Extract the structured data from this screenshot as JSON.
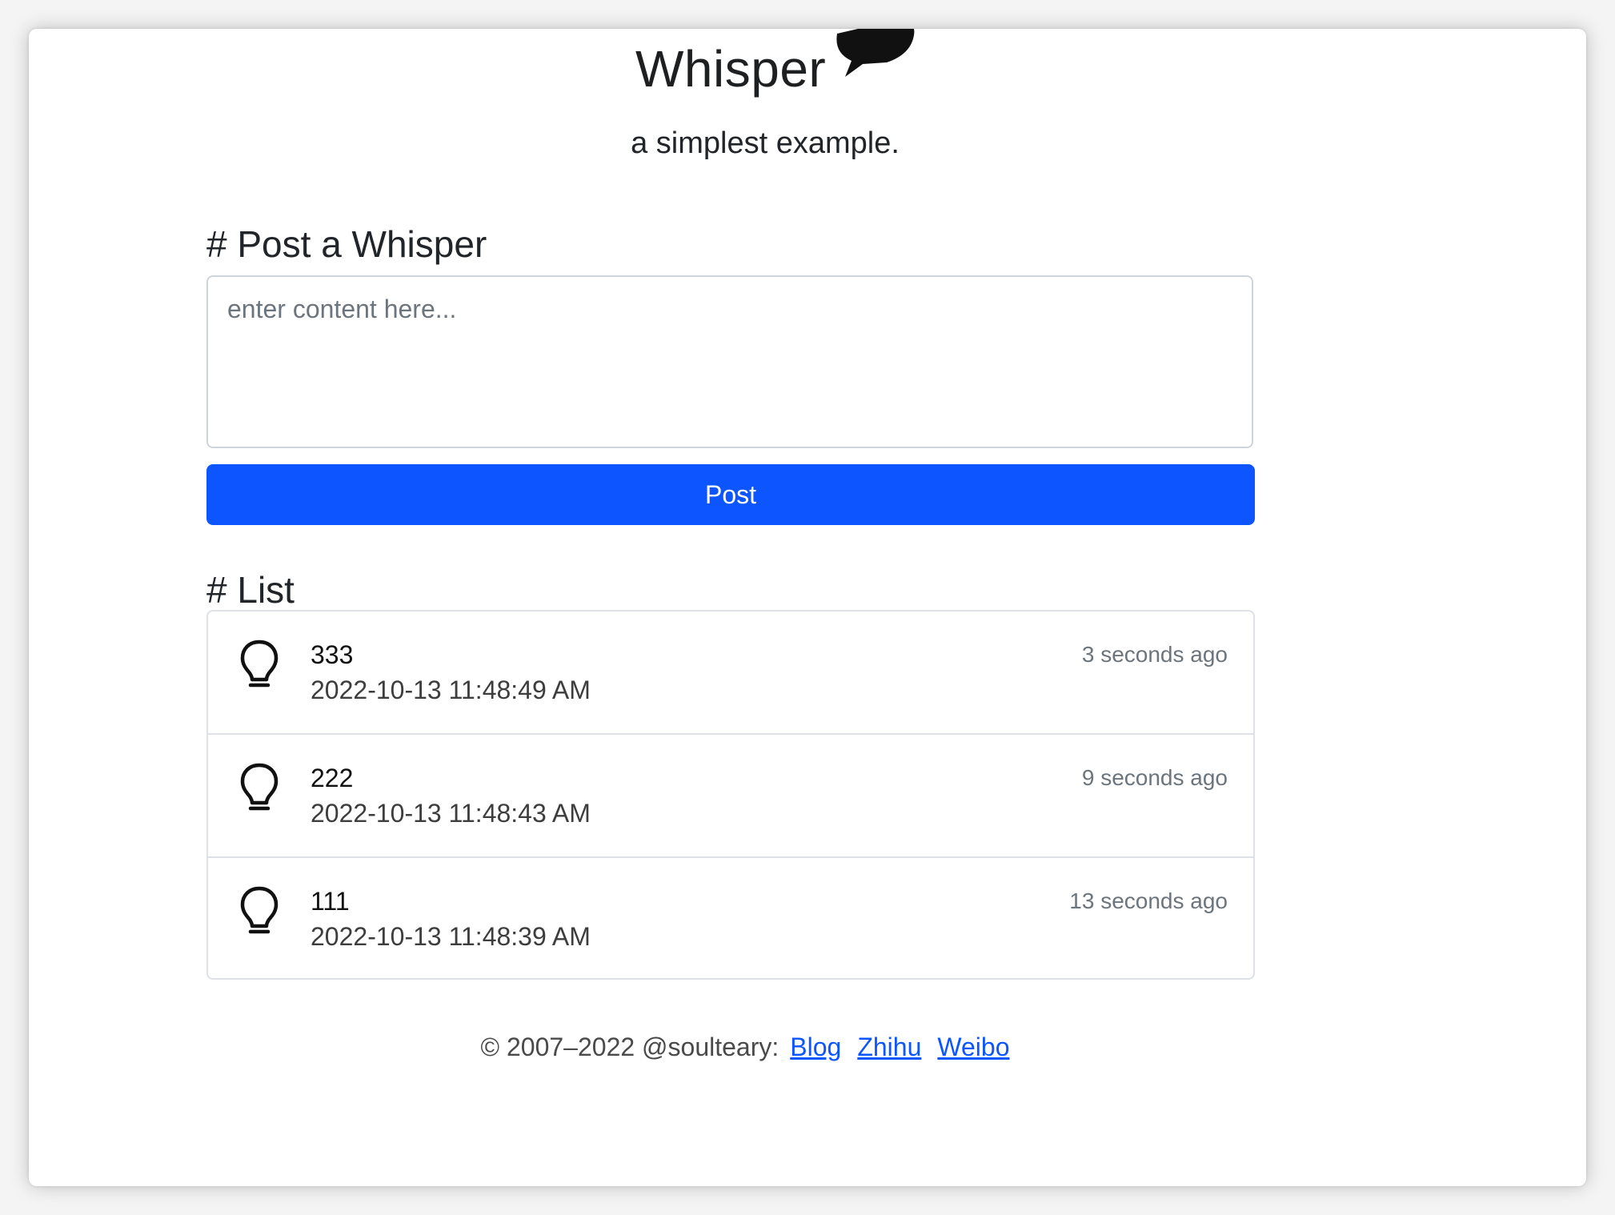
{
  "brand": {
    "title": "Whisper",
    "subtitle": "a simplest example.",
    "logo_icon": "speech-bubble-icon"
  },
  "post_section": {
    "heading": "# Post a Whisper",
    "placeholder": "enter content here...",
    "value": "",
    "button_label": "Post",
    "button_color": "#0d55ff"
  },
  "list_section": {
    "heading": "# List",
    "item_icon": "lightbulb-icon",
    "items": [
      {
        "title": "333",
        "date": "2022-10-13 11:48:49 AM",
        "ago": "3 seconds ago"
      },
      {
        "title": "222",
        "date": "2022-10-13 11:48:43 AM",
        "ago": "9 seconds ago"
      },
      {
        "title": "111",
        "date": "2022-10-13 11:48:39 AM",
        "ago": "13 seconds ago"
      }
    ]
  },
  "footer": {
    "copyright": "© 2007–2022 @soulteary:",
    "links": [
      {
        "label": "Blog"
      },
      {
        "label": "Zhihu"
      },
      {
        "label": "Weibo"
      }
    ]
  }
}
